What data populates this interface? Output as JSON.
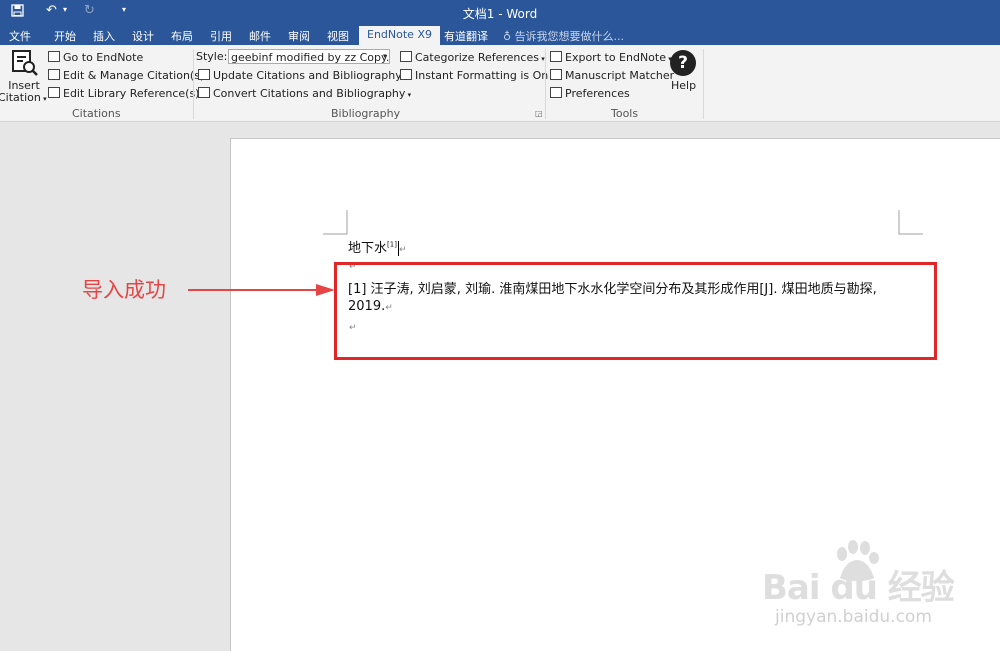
{
  "titlebar": {
    "doc_title": "文档1 - Word"
  },
  "tabs": [
    "文件",
    "开始",
    "插入",
    "设计",
    "布局",
    "引用",
    "邮件",
    "审阅",
    "视图",
    "EndNote X9",
    "有道翻译"
  ],
  "search_placeholder": "告诉我您想要做什么...",
  "ribbon": {
    "insert_citation": [
      "Insert",
      "Citation"
    ],
    "go_to_endnote": "Go to EndNote",
    "edit_manage_citations": "Edit & Manage Citation(s)",
    "edit_library_references": "Edit Library Reference(s)",
    "citations_group": "Citations",
    "style_label": "Style:",
    "style_value": "geebinf modified by zz Copy...",
    "update_citations": "Update Citations and Bibliography",
    "convert_citations": "Convert Citations and Bibliography",
    "categorize_references": "Categorize References",
    "instant_formatting": "Instant Formatting is On",
    "bibliography_group": "Bibliography",
    "export_to_endnote": "Export to EndNote",
    "manuscript_matcher": "Manuscript Matcher",
    "preferences": "Preferences",
    "help": "Help",
    "tools_group": "Tools"
  },
  "document": {
    "heading": "地下水",
    "citation_mark": "[1]",
    "para_mark": "↵",
    "reference_line1": "[1]   汪子涛, 刘启蒙, 刘瑜. 淮南煤田地下水水化学空间分布及其形成作用[J]. 煤田地质与勘探,",
    "reference_line2": "2019."
  },
  "annotation": {
    "text": "导入成功",
    "color": "#e64545"
  },
  "watermark": {
    "logo": "Bai du 经验",
    "url": "jingyan.baidu.com"
  }
}
